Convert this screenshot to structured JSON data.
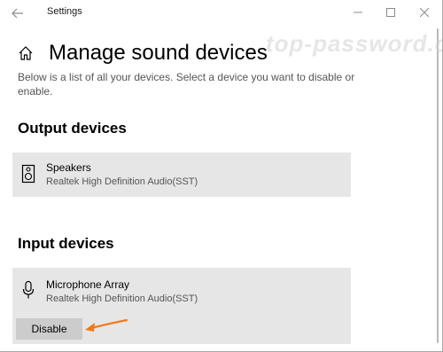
{
  "window": {
    "title": "Settings",
    "back_icon": "back-arrow-icon",
    "controls": {
      "minimize_icon": "minimize-icon",
      "maximize_icon": "maximize-icon",
      "close_icon": "close-icon"
    }
  },
  "header": {
    "home_icon": "home-icon",
    "title": "Manage sound devices",
    "watermark": "top-password.com",
    "description": "Below is a list of all your devices. Select a device you want to disable or enable."
  },
  "output_section": {
    "title": "Output devices",
    "devices": [
      {
        "icon": "speaker-icon",
        "name": "Speakers",
        "driver": "Realtek High Definition Audio(SST)"
      }
    ]
  },
  "input_section": {
    "title": "Input devices",
    "devices": [
      {
        "icon": "microphone-icon",
        "name": "Microphone Array",
        "driver": "Realtek High Definition Audio(SST)",
        "action_label": "Disable"
      }
    ]
  },
  "annotation": {
    "arrow_icon": "pointer-arrow-icon",
    "color": "#f07a1a"
  }
}
